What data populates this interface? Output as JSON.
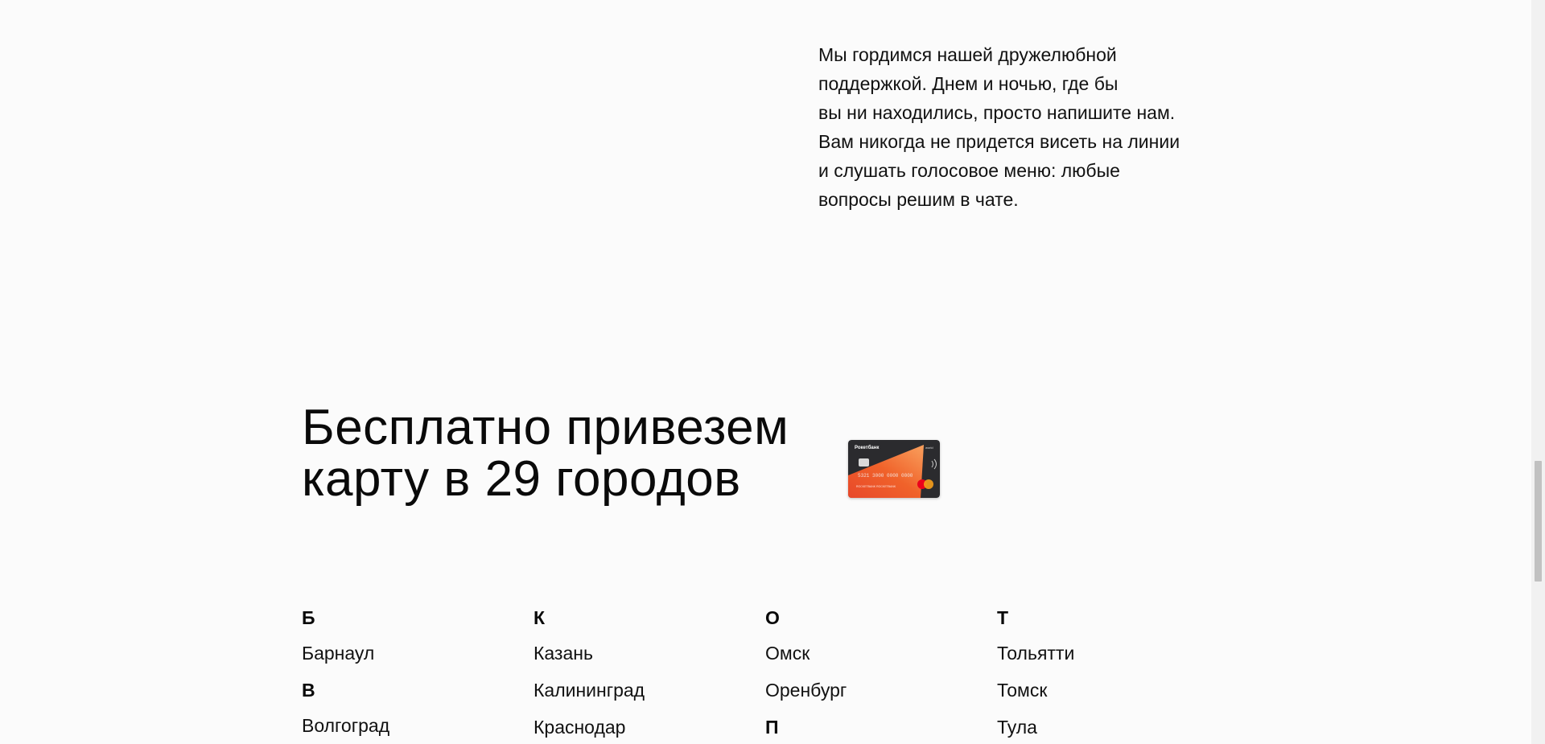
{
  "support": {
    "lines": [
      "Мы гордимся нашей дружелюбной",
      "поддержкой. Днем и ночью, где бы",
      "вы ни находились, просто напишите нам.",
      "Вам никогда не придется висеть на линии",
      "и слушать голосовое меню: любые",
      "вопросы решим в чате."
    ]
  },
  "hero": {
    "title_line1": "Бесплатно привезем",
    "title_line2": "карту в 29 городов"
  },
  "card": {
    "brand": "Рокетбанк",
    "network_label": "world",
    "number": "5321 3000 0000 0000",
    "holder": "ROCKETBANK ROCKETBANK",
    "colors": {
      "dark": "#2b2b2e",
      "orange": "#f0622a",
      "light_orange": "#f9a15e",
      "mc_red": "#eb001b",
      "mc_yellow": "#f79e1b"
    }
  },
  "cities": {
    "columns": [
      {
        "groups": [
          {
            "letter": "Б",
            "items": [
              "Барнаул"
            ]
          },
          {
            "letter": "В",
            "items": [
              "Волгоград"
            ]
          }
        ]
      },
      {
        "groups": [
          {
            "letter": "К",
            "items": [
              "Казань",
              "Калининград",
              "Краснодар"
            ]
          }
        ]
      },
      {
        "groups": [
          {
            "letter": "О",
            "items": [
              "Омск",
              "Оренбург"
            ]
          },
          {
            "letter": "П",
            "items": []
          }
        ]
      },
      {
        "groups": [
          {
            "letter": "Т",
            "items": [
              "Тольятти",
              "Томск",
              "Тула"
            ]
          }
        ]
      }
    ]
  }
}
